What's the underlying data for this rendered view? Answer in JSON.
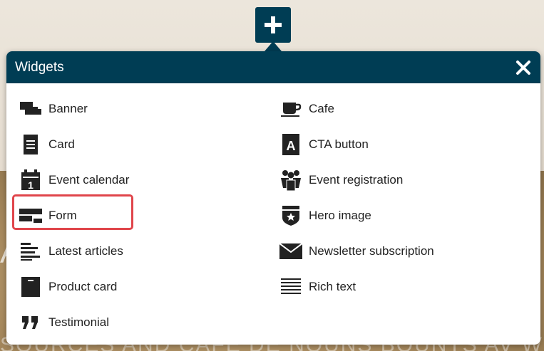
{
  "background": {
    "letter": "A",
    "strip_text": "SOURCES AND CAFE DE NOUNS BOUNTS AV W"
  },
  "add_button": {
    "icon": "plus-icon"
  },
  "panel": {
    "title": "Widgets",
    "close_icon": "close-icon",
    "left_column": [
      {
        "label": "Banner",
        "icon": "banner-icon"
      },
      {
        "label": "Card",
        "icon": "card-icon"
      },
      {
        "label": "Event calendar",
        "icon": "calendar-icon",
        "highlighted": true
      },
      {
        "label": "Form",
        "icon": "form-icon"
      },
      {
        "label": "Latest articles",
        "icon": "latest-articles-icon"
      },
      {
        "label": "Product card",
        "icon": "product-card-icon"
      },
      {
        "label": "Testimonial",
        "icon": "quote-icon"
      }
    ],
    "right_column": [
      {
        "label": "Cafe",
        "icon": "coffee-cup-icon"
      },
      {
        "label": "CTA button",
        "icon": "cta-a-icon"
      },
      {
        "label": "Event registration",
        "icon": "people-icon"
      },
      {
        "label": "Hero image",
        "icon": "badge-star-icon"
      },
      {
        "label": "Newsletter subscription",
        "icon": "envelope-icon"
      },
      {
        "label": "Rich text",
        "icon": "rich-text-icon"
      }
    ]
  },
  "colors": {
    "header": "#003d54",
    "highlight": "#e0454b",
    "text": "#222222"
  }
}
